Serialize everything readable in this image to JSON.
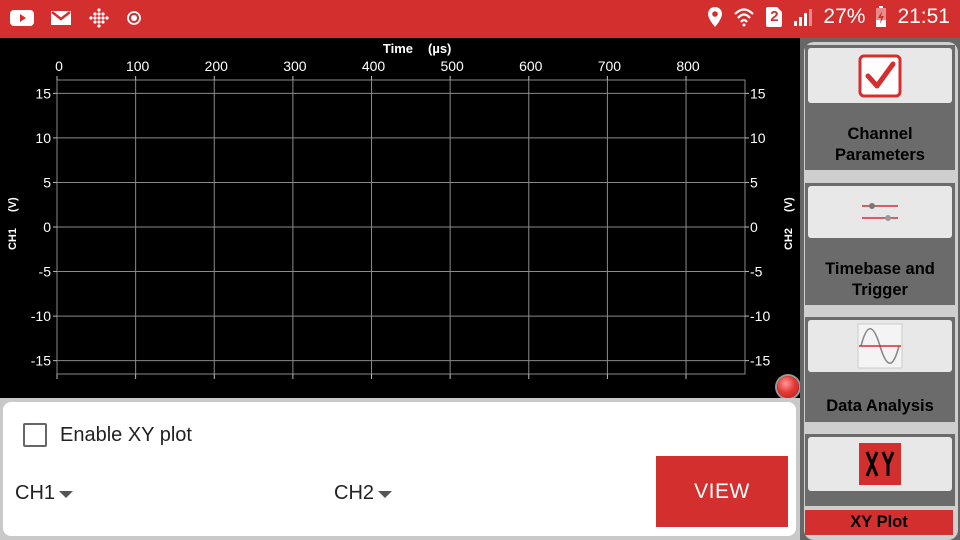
{
  "status_bar": {
    "icons_left": [
      "youtube-icon",
      "gmail-icon",
      "dots-grid-icon",
      "record-dot-icon"
    ],
    "icons_right": [
      "location-icon",
      "wifi-icon",
      "sim2-icon",
      "signal-icon"
    ],
    "sim_slot": "2",
    "battery": "27%",
    "time": "21:51",
    "color": "#d32f2f"
  },
  "plot": {
    "x_title": "Time",
    "x_unit": "(µs)",
    "left_axis_title": "CH1",
    "left_axis_unit": "(V)",
    "right_axis_title": "CH2",
    "right_axis_unit": "(V)"
  },
  "chart_data": {
    "type": "line",
    "title": "",
    "xlabel": "Time (µs)",
    "ylabel": "CH1 (V)",
    "y2label": "CH2 (V)",
    "x_ticks": [
      0,
      100,
      200,
      300,
      400,
      500,
      600,
      700,
      800
    ],
    "y_ticks": [
      15,
      10,
      5,
      0,
      -5,
      -10,
      -15
    ],
    "xlim": [
      0,
      875
    ],
    "ylim": [
      -16.5,
      16.5
    ],
    "grid": true,
    "series": []
  },
  "xy_panel": {
    "enable_label": "Enable XY plot",
    "enabled": false,
    "x_channel": "CH1",
    "y_channel": "CH2",
    "view_label": "VIEW",
    "accent": "#d32f2f"
  },
  "sidebar": {
    "items": [
      {
        "label_line1": "Channel",
        "label_line2": "Parameters",
        "icon": "checkmark-icon"
      },
      {
        "label_line1": "Timebase and",
        "label_line2": "Trigger",
        "icon": "sliders-icon"
      },
      {
        "label_line1": "Data Analysis",
        "label_line2": "",
        "icon": "sine-wave-icon"
      },
      {
        "label_line1": "XY Plot",
        "label_line2": "",
        "icon": "xy-plot-icon",
        "active": true
      }
    ]
  }
}
